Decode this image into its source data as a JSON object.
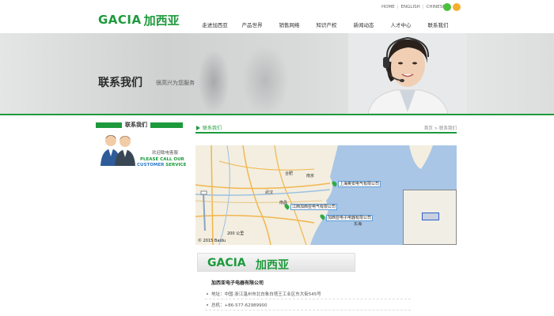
{
  "header": {
    "logo_mark": "GACIA",
    "logo_cn": "加西亚",
    "lang": [
      "HOME",
      "ENGLISH",
      "CHINESE"
    ],
    "nav": [
      "走进加西亚",
      "产品世界",
      "销售网络",
      "知识产权",
      "新闻动态",
      "人才中心",
      "联系我们"
    ]
  },
  "banner": {
    "title": "联系我们",
    "subtitle": "很高兴为您服务"
  },
  "sidebar": {
    "heading": "联系我们",
    "welcome": "欢迎致电客服",
    "call_line1": "PLEASE CALL OUR",
    "call_line2_a": "CUSTOMER",
    "call_line2_b": "SERVICE"
  },
  "main": {
    "crumb_title": "联系我们",
    "crumb_home": "首页",
    "crumb_sep": ">",
    "crumb_current": "联系我们",
    "map": {
      "pins": [
        {
          "label": "上海奥安电气有限公司"
        },
        {
          "label": "江西加西亚电气有限公司"
        },
        {
          "label": "加西亚电子电器有限公司"
        }
      ],
      "cities": [
        "合肥",
        "南京",
        "武汉",
        "南昌",
        "东海"
      ],
      "scale": "200 公里",
      "copyright": "© 2015 Baidu"
    },
    "company_logo_mark": "GACIA",
    "company_logo_cn": "加西亚",
    "company_name": "加西亚电子电器有限公司",
    "address": "地址：中国·浙江温州市北白象白塔王工业区东大街545号",
    "phone": "总机：+86-577-62989900"
  },
  "colors": {
    "brand_green": "#1d9a3c",
    "accent_blue": "#2f79c8"
  }
}
